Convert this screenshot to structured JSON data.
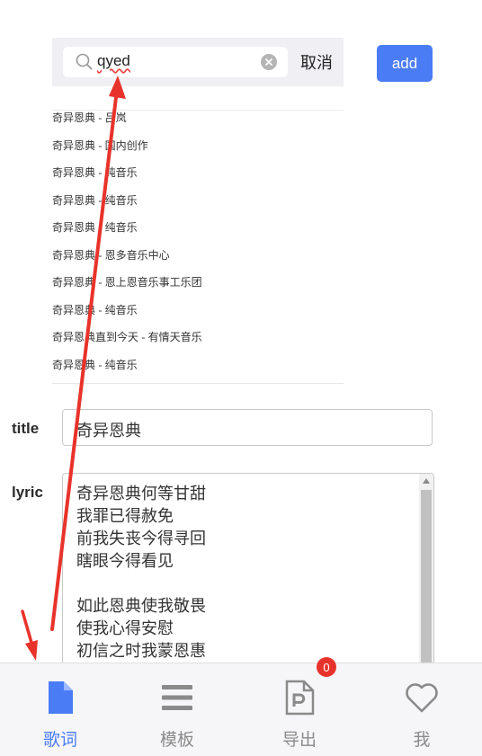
{
  "search": {
    "query": "qyed",
    "cancel_label": "取消"
  },
  "add_button": {
    "label": "add"
  },
  "results": [
    "奇异恩典 - 吕岚",
    "奇异恩典 - 国内创作",
    "奇异恩典 - 纯音乐",
    "奇异恩典 - 纯音乐",
    "奇异恩典 - 纯音乐",
    "奇异恩典 - 恩多音乐中心",
    "奇异恩典 - 恩上恩音乐事工乐团",
    "奇异恩典 - 纯音乐",
    "奇异恩典直到今天 - 有情天音乐",
    "奇异恩典 - 纯音乐"
  ],
  "form": {
    "title_label": "title",
    "title_value": "奇异恩典",
    "lyric_label": "lyric",
    "lyric_lines": [
      "奇异恩典何等甘甜",
      "我罪已得赦免",
      "前我失丧今得寻回",
      "瞎眼今得看见",
      "",
      "如此恩典使我敬畏",
      "使我心得安慰",
      "初信之时我蒙恩惠"
    ]
  },
  "tabbar": {
    "tabs": [
      {
        "label": "歌词",
        "icon": "document-icon",
        "active": true
      },
      {
        "label": "模板",
        "icon": "menu-icon",
        "active": false
      },
      {
        "label": "导出",
        "icon": "ppt-file-icon",
        "active": false
      },
      {
        "label": "我",
        "icon": "heart-icon",
        "active": false
      }
    ],
    "export_badge": "0"
  },
  "colors": {
    "accent": "#4a7cf6",
    "badge": "#e8332b",
    "annotation": "#e8332b"
  }
}
